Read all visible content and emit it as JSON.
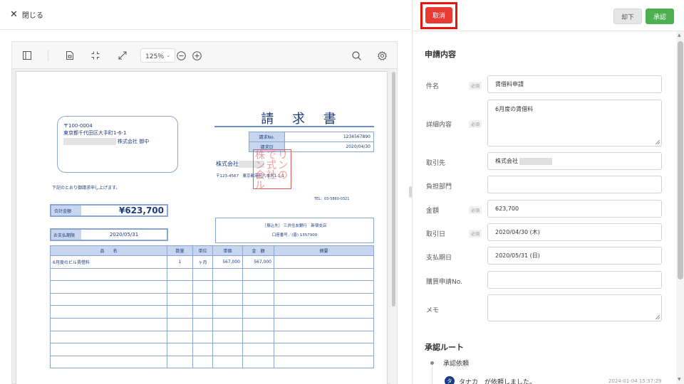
{
  "header": {
    "close_icon": "close-icon",
    "close_label": "閉じる"
  },
  "viewer": {
    "zoom": "125％",
    "icons": [
      "sidebar-toggle-icon",
      "document-icon",
      "fit-screen-icon",
      "expand-icon",
      "zoom-out-icon",
      "zoom-in-icon",
      "search-icon",
      "settings-icon"
    ]
  },
  "invoice": {
    "title": "請 求 書",
    "postal": "〒100-0004",
    "address": "東京都千代田区大手町1-6-1",
    "recipient": "株式会社 御中",
    "meta": [
      {
        "label": "請求No.",
        "value": "1234567890"
      },
      {
        "label": "請求日",
        "value": "2020/04/30"
      }
    ],
    "company": "株式会社",
    "company_address": "〒123-4567　東京都港区六本木1-1-1",
    "hanko": "株でリン式ン会社のル",
    "tel": "TEL：03-5860-0321",
    "note": "下記のとおり御請求申し上げます。",
    "total_label": "合計金額",
    "total_value": "¥623,700",
    "pay_label": "お支払期限",
    "pay_value": "2020/05/31",
    "bank_line1": "［振込先］ 三井住友銀行　新宿支店",
    "bank_line2": "口座番号／(普) 1357900",
    "columns": [
      "品　　名",
      "数量",
      "単位",
      "単価",
      "金　額",
      "摘要"
    ],
    "rows": [
      [
        "6月度のビル賃借料",
        "1",
        "ヶ月",
        "567,000",
        "567,000",
        ""
      ],
      [
        "",
        "",
        "",
        "",
        "",
        ""
      ],
      [
        "",
        "",
        "",
        "",
        "",
        ""
      ],
      [
        "",
        "",
        "",
        "",
        "",
        ""
      ],
      [
        "",
        "",
        "",
        "",
        "",
        ""
      ],
      [
        "",
        "",
        "",
        "",
        "",
        ""
      ],
      [
        "",
        "",
        "",
        "",
        "",
        ""
      ],
      [
        "",
        "",
        "",
        "",
        "",
        ""
      ],
      [
        "",
        "",
        "",
        "",
        "",
        ""
      ]
    ]
  },
  "actions": {
    "cancel": "取消",
    "reject": "却下",
    "approve": "承認"
  },
  "form": {
    "section_title": "申請内容",
    "required_tag": "必須",
    "fields": {
      "subject": {
        "label": "件名",
        "value": "賃借料申請"
      },
      "details": {
        "label": "詳細内容",
        "value": "6月度の賃借料"
      },
      "vendor": {
        "label": "取引先",
        "value": "株式会社"
      },
      "department": {
        "label": "負担部門",
        "value": ""
      },
      "amount": {
        "label": "金額",
        "value": "623,700"
      },
      "trade_date": {
        "label": "取引日",
        "value": "2020/04/30 (木)"
      },
      "due_date": {
        "label": "支払期日",
        "value": "2020/05/31 (日)"
      },
      "purchase_no": {
        "label": "購買申請No.",
        "value": ""
      },
      "memo": {
        "label": "メモ",
        "value": ""
      }
    }
  },
  "route": {
    "title": "承認ルート",
    "step_label": "承認依頼",
    "avatar_initial": "タ",
    "log_text": "タナカ　が依頼しました。",
    "log_time": "2024-01-04 15:37:29"
  }
}
